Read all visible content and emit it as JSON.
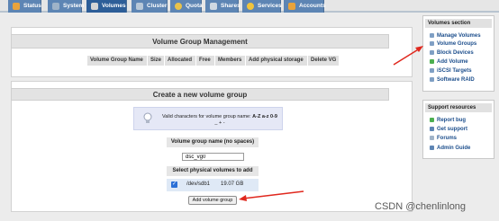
{
  "nav": {
    "tabs": [
      {
        "label": "Status",
        "icon": "status-icon",
        "color": "#e8a33c",
        "active": false
      },
      {
        "label": "System",
        "icon": "system-icon",
        "color": "#9fb3c8",
        "active": false
      },
      {
        "label": "Volumes",
        "icon": "volumes-icon",
        "color": "#d5d5d5",
        "active": true
      },
      {
        "label": "Cluster",
        "icon": "cluster-icon",
        "color": "#b8c8d8",
        "active": false
      },
      {
        "label": "Quota",
        "icon": "quota-icon",
        "color": "#e8c24a",
        "active": false
      },
      {
        "label": "Shares",
        "icon": "shares-icon",
        "color": "#cfd8e2",
        "active": false
      },
      {
        "label": "Services",
        "icon": "services-icon",
        "color": "#f0c43c",
        "active": false
      },
      {
        "label": "Accounts",
        "icon": "accounts-icon",
        "color": "#e8a33c",
        "active": false
      }
    ]
  },
  "vg_management": {
    "title": "Volume Group Management",
    "columns": [
      "Volume Group Name",
      "Size",
      "Allocated",
      "Free",
      "Members",
      "Add physical storage",
      "Delete VG"
    ]
  },
  "create_vg": {
    "title": "Create a new volume group",
    "info_prefix": "Valid characters for volume group name:",
    "info_chars": "A-Z a-z 0-9",
    "info_extra": "_ + -",
    "name_label": "Volume group name (no spaces)",
    "name_value": "dsc_vg0",
    "pv_label": "Select physical volumes to add",
    "pv": {
      "checked": true,
      "device": "/dev/sdb1",
      "size": "19.07 GB"
    },
    "submit_label": "Add volume group"
  },
  "sidebar": {
    "volumes_section": {
      "title": "Volumes section",
      "items": [
        {
          "label": "Manage Volumes",
          "icon": "manage-volumes-icon",
          "color": "#7f9fc4"
        },
        {
          "label": "Volume Groups",
          "icon": "volume-groups-icon",
          "color": "#7f9fc4"
        },
        {
          "label": "Block Devices",
          "icon": "block-devices-icon",
          "color": "#7f9fc4"
        },
        {
          "label": "Add Volume",
          "icon": "add-volume-icon",
          "color": "#4caf50"
        },
        {
          "label": "iSCSI Targets",
          "icon": "iscsi-targets-icon",
          "color": "#7f9fc4"
        },
        {
          "label": "Software RAID",
          "icon": "software-raid-icon",
          "color": "#7f9fc4"
        }
      ]
    },
    "support_resources": {
      "title": "Support resources",
      "items": [
        {
          "label": "Report bug",
          "icon": "report-bug-icon",
          "color": "#4caf50"
        },
        {
          "label": "Get support",
          "icon": "get-support-icon",
          "color": "#5d85b4"
        },
        {
          "label": "Forums",
          "icon": "forums-icon",
          "color": "#9fb3c8"
        },
        {
          "label": "Admin Guide",
          "icon": "admin-guide-icon",
          "color": "#5d85b4"
        }
      ]
    }
  },
  "annotation_color": "#e0281e",
  "watermark": "CSDN @chenlinlong"
}
